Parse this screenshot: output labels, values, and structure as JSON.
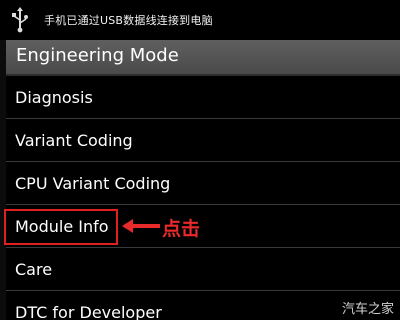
{
  "status_bar": {
    "usb_icon": "usb-icon",
    "notification": "手机已通过USB数据线连接到电脑"
  },
  "title_bar": {
    "title": "Engineering Mode"
  },
  "menu": {
    "items": [
      {
        "label": "Diagnosis"
      },
      {
        "label": "Variant Coding"
      },
      {
        "label": "CPU Variant Coding"
      },
      {
        "label": "Module Info"
      },
      {
        "label": "Care"
      },
      {
        "label": "DTC for Developer"
      }
    ]
  },
  "annotation": {
    "text": "点击",
    "color": "#e82a2a",
    "arrow_icon": "arrow-left-icon"
  },
  "watermark": {
    "text": "汽车之家"
  }
}
